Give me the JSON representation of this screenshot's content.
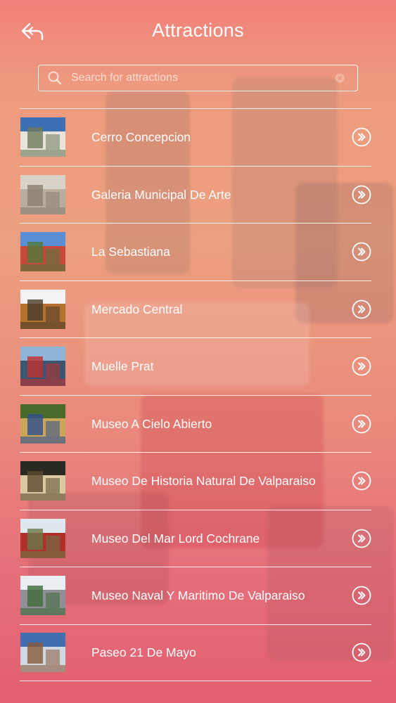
{
  "header": {
    "title": "Attractions"
  },
  "search": {
    "placeholder": "Search for attractions",
    "value": ""
  },
  "attractions": [
    {
      "name": "Cerro Concepcion",
      "thumb_colors": [
        "#3d6fb3",
        "#e8e4dc",
        "#6b7a5a"
      ]
    },
    {
      "name": "Galeria Municipal De Arte",
      "thumb_colors": [
        "#d8d2c8",
        "#b8ad9e",
        "#8a7f70"
      ]
    },
    {
      "name": "La Sebastiana",
      "thumb_colors": [
        "#5a8fd6",
        "#c64a3a",
        "#4f7a3a"
      ]
    },
    {
      "name": "Mercado Central",
      "thumb_colors": [
        "#f2f2f2",
        "#b5722f",
        "#4a3a2a"
      ]
    },
    {
      "name": "Muelle Prat",
      "thumb_colors": [
        "#8fb5d9",
        "#3a5670",
        "#c23030"
      ]
    },
    {
      "name": "Museo A Cielo Abierto",
      "thumb_colors": [
        "#4a6a2a",
        "#c9a65a",
        "#2f4f8f"
      ]
    },
    {
      "name": "Museo De Historia Natural De Valparaiso",
      "thumb_colors": [
        "#2a2a22",
        "#d9c9a0",
        "#5a4a30"
      ]
    },
    {
      "name": "Museo Del Mar Lord Cochrane",
      "thumb_colors": [
        "#dfe8ef",
        "#b0302c",
        "#6a7a4a"
      ]
    },
    {
      "name": "Museo Naval Y Maritimo De Valparaiso",
      "thumb_colors": [
        "#e9eef3",
        "#8f8f95",
        "#3f6a3a"
      ]
    },
    {
      "name": "Paseo 21 De Mayo",
      "thumb_colors": [
        "#3f6fae",
        "#cfd8e3",
        "#8a5a3a"
      ]
    }
  ]
}
